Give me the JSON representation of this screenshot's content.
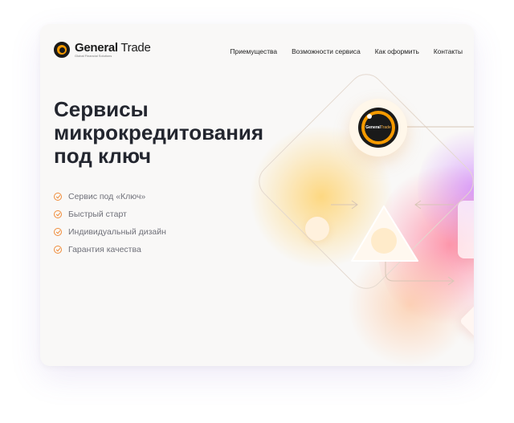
{
  "brand": {
    "name_bold": "General",
    "name_light": "Trade",
    "tagline": "Global Financial Solutions"
  },
  "nav": {
    "items": [
      {
        "label": "Приемущества"
      },
      {
        "label": "Возможности сервиса"
      },
      {
        "label": "Как оформить"
      },
      {
        "label": "Контакты"
      }
    ]
  },
  "hero": {
    "title_lines": [
      "Сервисы",
      "микрокредитования",
      "под ключ"
    ],
    "features": [
      {
        "label": "Сервис под «Ключ»",
        "icon": "check-circle-icon"
      },
      {
        "label": "Быстрый старт",
        "icon": "check-circle-icon"
      },
      {
        "label": "Индивидуальный дизайн",
        "icon": "check-circle-icon"
      },
      {
        "label": "Гарантия качества",
        "icon": "check-circle-icon"
      }
    ]
  },
  "colors": {
    "accent_orange": "#f08c3a",
    "brand_gold": "#f59a00",
    "title": "#23262f",
    "glow_yellow": "#ffd36b",
    "glow_pink": "#ff7aa0",
    "glow_purple": "#c77dff"
  }
}
